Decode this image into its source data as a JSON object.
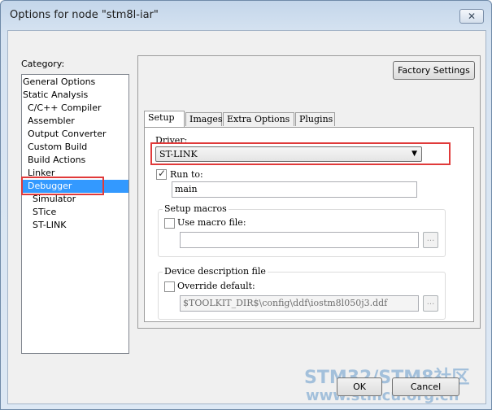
{
  "window": {
    "title": "Options for node \"stm8l-iar\"",
    "close_glyph": "✕"
  },
  "category": {
    "label": "Category:",
    "items": [
      {
        "label": "General Options"
      },
      {
        "label": "Static Analysis"
      },
      {
        "label": "C/C++ Compiler"
      },
      {
        "label": "Assembler"
      },
      {
        "label": "Output Converter"
      },
      {
        "label": "Custom Build"
      },
      {
        "label": "Build Actions"
      },
      {
        "label": "Linker"
      },
      {
        "label": "Debugger",
        "selected": true
      },
      {
        "label": "Simulator"
      },
      {
        "label": "STice"
      },
      {
        "label": "ST-LINK"
      }
    ]
  },
  "panel": {
    "factory_settings": "Factory Settings",
    "tabs": [
      {
        "label": "Setup",
        "active": true
      },
      {
        "label": "Images"
      },
      {
        "label": "Extra Options"
      },
      {
        "label": "Plugins"
      }
    ],
    "driver": {
      "label": "Driver:",
      "value": "ST-LINK",
      "arrow": "▼"
    },
    "run_to": {
      "label": "Run to:",
      "checked": true,
      "value": "main"
    },
    "setup_macros": {
      "title": "Setup macros",
      "checkbox_label": "Use macro file:",
      "checked": false,
      "value": "",
      "browse": "..."
    },
    "device_description": {
      "title": "Device description file",
      "checkbox_label": "Override default:",
      "checked": false,
      "value": "$TOOLKIT_DIR$\\config\\ddf\\iostm8l050j3.ddf",
      "browse": "..."
    }
  },
  "buttons": {
    "ok": "OK",
    "cancel": "Cancel"
  },
  "watermark": {
    "line1": "STM32/STM8社区",
    "line2": "www.stmcu.org.cn"
  },
  "colors": {
    "highlight": "#e03a3a",
    "selection": "#3399ff"
  }
}
